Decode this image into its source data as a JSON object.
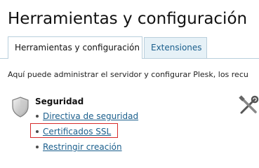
{
  "header": {
    "title": "Herramientas y configuración"
  },
  "tabs": [
    {
      "label": "Herramientas y configuración",
      "active": true
    },
    {
      "label": "Extensiones",
      "active": false
    }
  ],
  "intro_text": "Aquí puede administrar el servidor y configurar Plesk, los recu",
  "security_section": {
    "title": "Seguridad",
    "icon": "shield-icon",
    "links": [
      {
        "label": "Directiva de seguridad"
      },
      {
        "label": "Certificados SSL",
        "highlighted": true
      },
      {
        "label": "Restringir creación"
      }
    ]
  },
  "side_icon": "tools-icon",
  "colors": {
    "link": "#1a5e8c",
    "tab_border": "#b9cfdc",
    "inactive_tab_bg": "#e6f1f7",
    "highlight": "#d62b2b"
  }
}
